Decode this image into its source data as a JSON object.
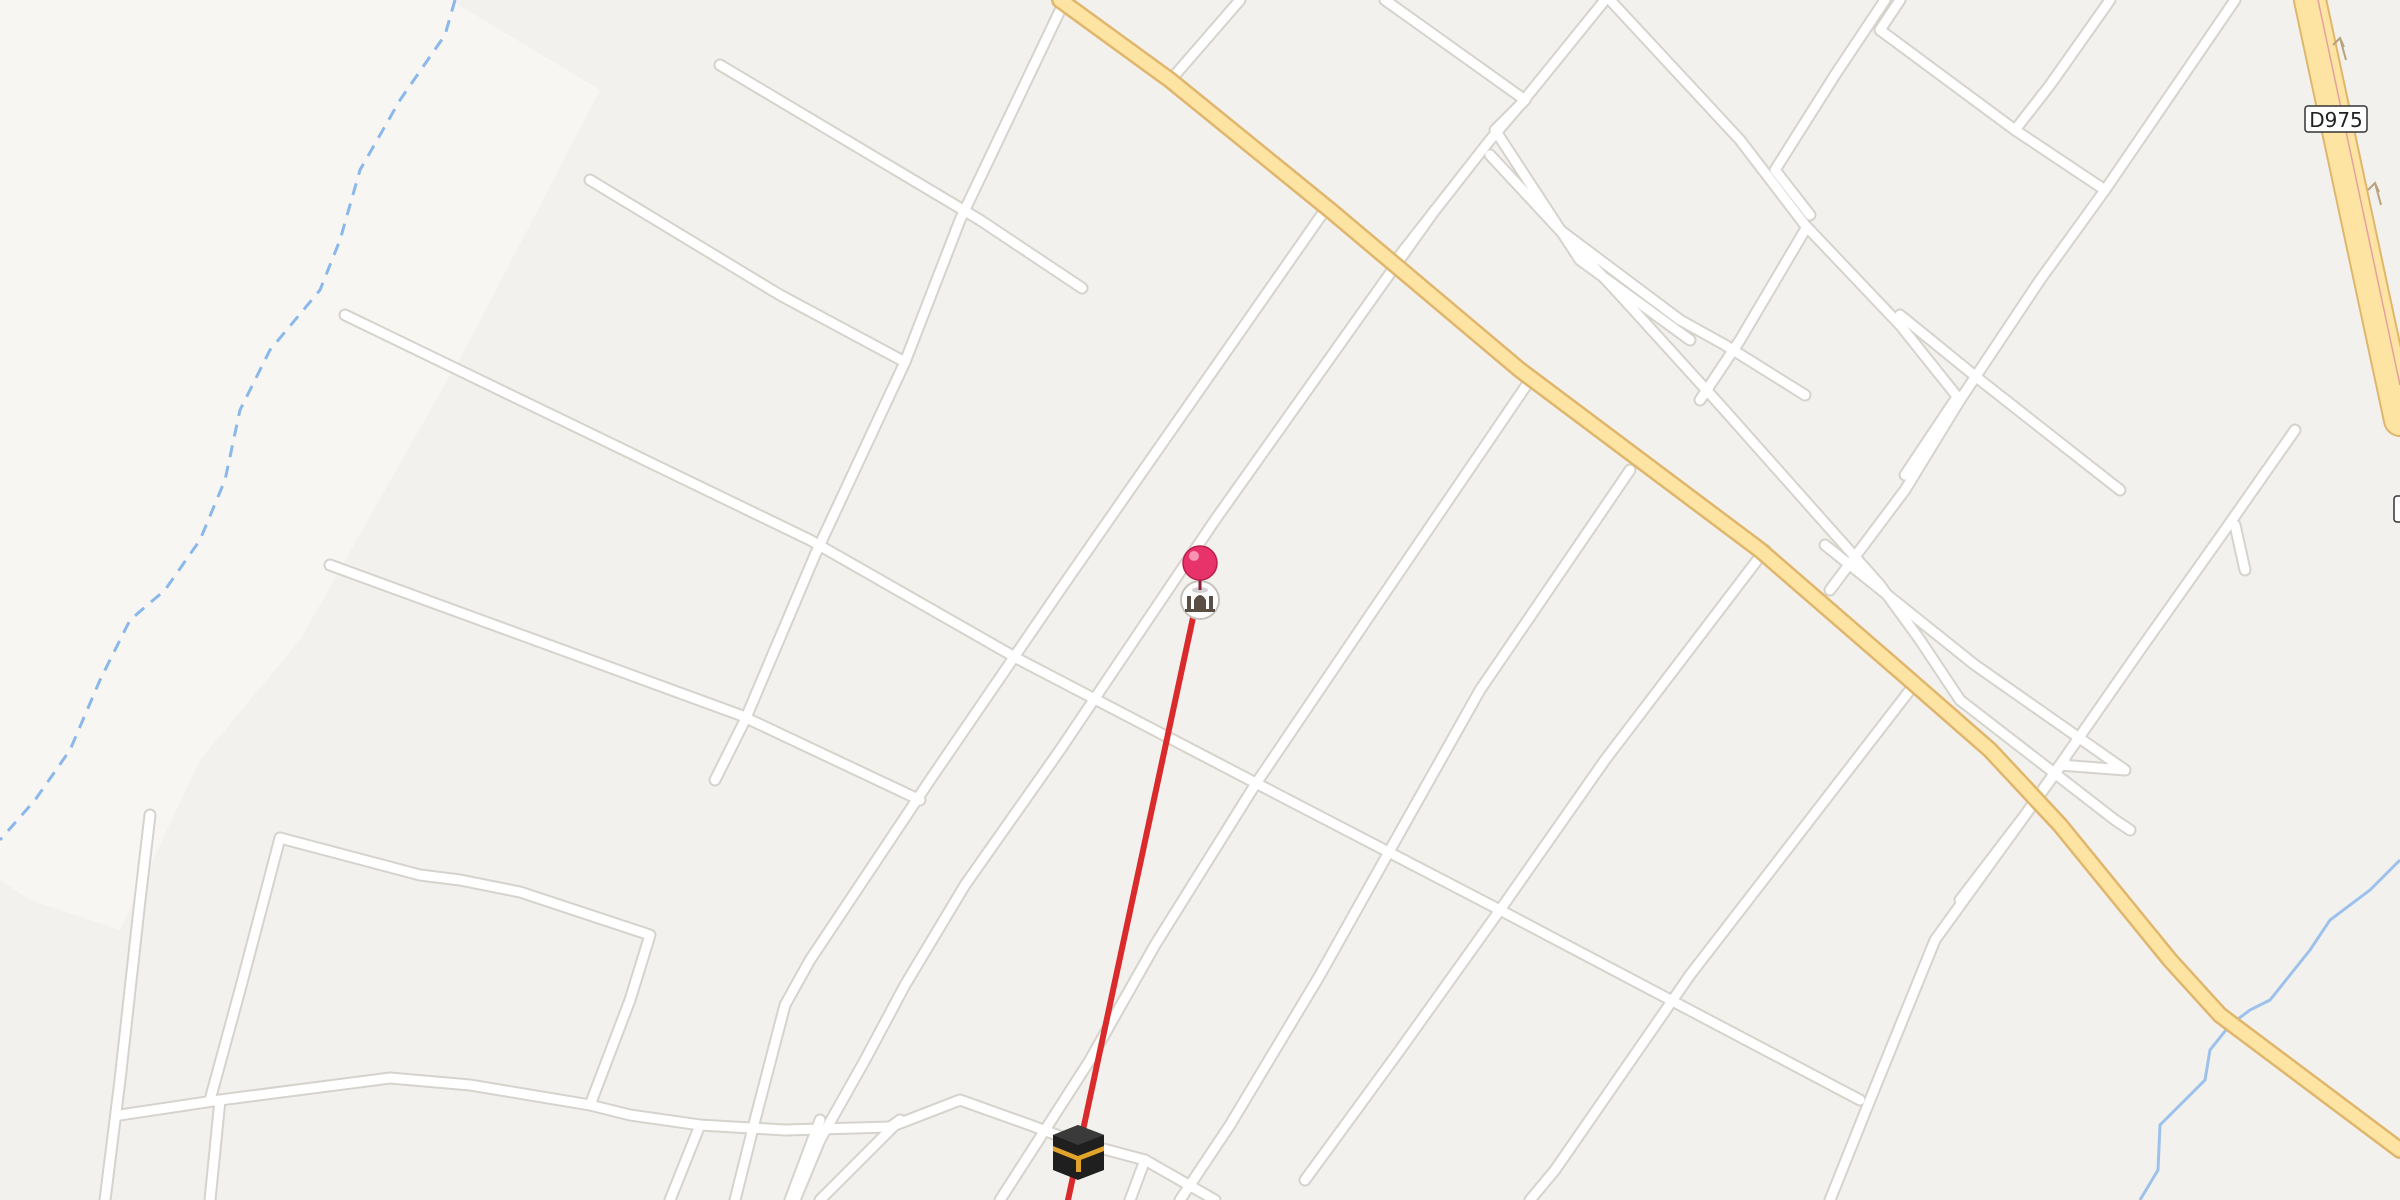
{
  "map": {
    "road_labels": [
      {
        "id": "d975",
        "text": "D975"
      }
    ],
    "markers": [
      {
        "id": "selected-pin",
        "type": "pin",
        "color": "#e8336a"
      },
      {
        "id": "mosque",
        "type": "poi",
        "icon": "mosque-icon"
      },
      {
        "id": "kaaba",
        "type": "poi",
        "icon": "kaaba-icon"
      }
    ],
    "route": {
      "color": "#d92b2b",
      "style": "solid"
    },
    "waterway": {
      "color": "#8ab8ea",
      "style": "dashed"
    },
    "colors": {
      "background": "#f3f1ee",
      "major_road": "#fde4a3",
      "minor_road": "#ffffff",
      "river": "#9cc2ec"
    }
  }
}
